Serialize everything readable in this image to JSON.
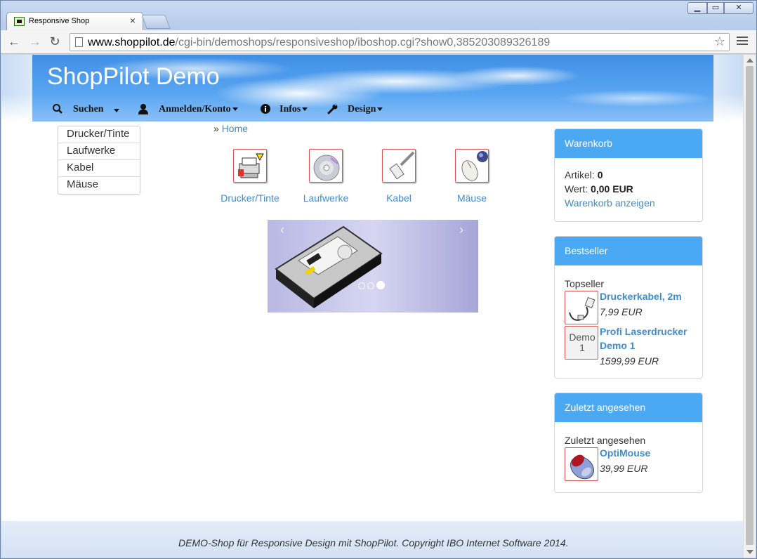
{
  "browser": {
    "tab_title": "Responsive Shop",
    "tab_close": "×",
    "window_controls": {
      "minimize": "▁",
      "maximize": "▭",
      "close": "✕"
    },
    "url_host": "www.shoppilot.de",
    "url_path": "/cgi-bin/demoshops/responsiveshop/iboshop.cgi?show0,385203089326189",
    "back": "←",
    "forward": "→",
    "reload": "↻",
    "star": "☆"
  },
  "header": {
    "title": "ShopPilot Demo",
    "nav": [
      {
        "label": "Suchen",
        "icon": "search-icon"
      },
      {
        "label": "Anmelden/Konto",
        "icon": "user-icon"
      },
      {
        "label": "Infos",
        "icon": "info-icon"
      },
      {
        "label": "Design",
        "icon": "wrench-icon"
      }
    ]
  },
  "sidebar": {
    "categories": [
      "Drucker/Tinte",
      "Laufwerke",
      "Kabel",
      "Mäuse"
    ]
  },
  "breadcrumb": {
    "sep": "»",
    "home": "Home"
  },
  "category_tiles": [
    {
      "label": "Drucker/Tinte",
      "icon": "printer-icon"
    },
    {
      "label": "Laufwerke",
      "icon": "cd-icon"
    },
    {
      "label": "Kabel",
      "icon": "cable-icon"
    },
    {
      "label": "Mäuse",
      "icon": "mouse-icon"
    }
  ],
  "carousel": {
    "prev": "‹",
    "next": "›",
    "slides": 3,
    "active": 3
  },
  "cart": {
    "title": "Warenkorb",
    "items_label": "Artikel:",
    "items_value": "0",
    "value_label": "Wert:",
    "value_value": "0,00 EUR",
    "show_link": "Warenkorb anzeigen"
  },
  "bestseller": {
    "title": "Bestseller",
    "subtitle": "Topseller",
    "products": [
      {
        "name": "Druckerkabel, 2m",
        "price": "7,99 EUR"
      },
      {
        "name": "Profi Laserdrucker Demo 1",
        "price": "1599,99 EUR",
        "thumb_text": "Demo 1"
      }
    ]
  },
  "recent": {
    "title": "Zuletzt angesehen",
    "subtitle": "Zuletzt angesehen",
    "products": [
      {
        "name": "OptiMouse",
        "price": "39,99 EUR"
      }
    ]
  },
  "footer": {
    "text": "DEMO-Shop für Responsive Design mit ShopPilot. Copyright IBO Internet Software 2014."
  },
  "colors": {
    "accent": "#428bca",
    "panel_header": "#4ba9f4",
    "thumb_border": "#d9534f"
  }
}
